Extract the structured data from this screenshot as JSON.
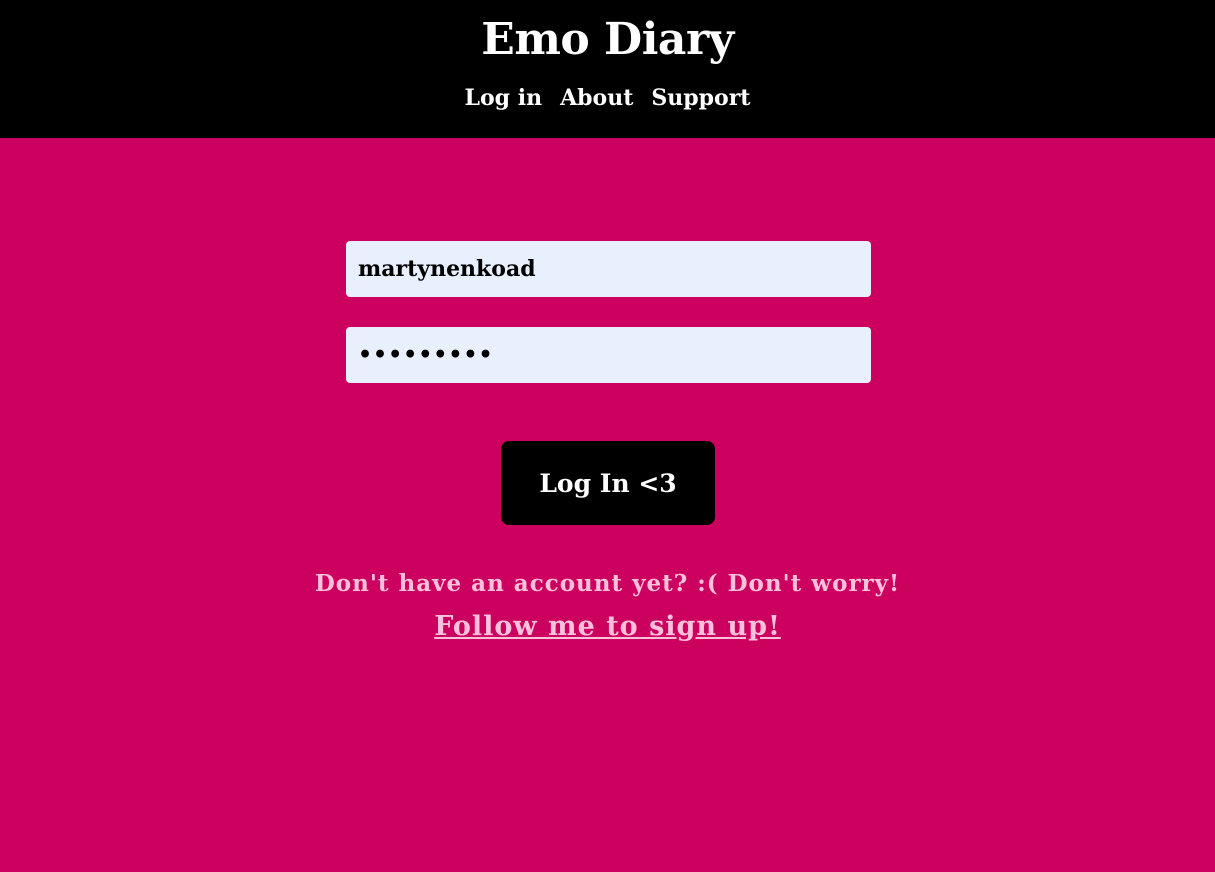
{
  "header": {
    "title": "Emo Diary",
    "nav": [
      {
        "label": "Log in"
      },
      {
        "label": "About"
      },
      {
        "label": "Support"
      }
    ]
  },
  "login_form": {
    "username_value": "martynenkoad",
    "password_value": "•••••••••",
    "submit_label": "Log In <3"
  },
  "signup": {
    "prompt": "Don't have an account yet? :( Don't worry!",
    "link_label": "Follow me to sign up!"
  },
  "colors": {
    "background": "#cc005e",
    "header": "#000000",
    "input_bg": "#e8f0fe",
    "signup_text": "#ffc0dc"
  }
}
